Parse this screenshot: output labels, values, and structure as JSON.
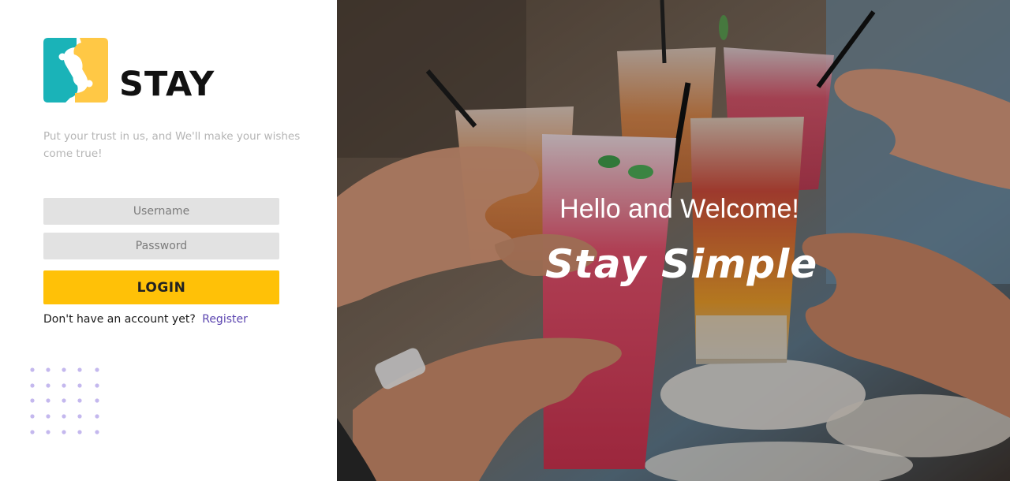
{
  "brand": {
    "name": "STAY",
    "tagline": "Put your trust in us, and We'll make your wishes come true!"
  },
  "login_form": {
    "username_placeholder": "Username",
    "password_placeholder": "Password",
    "login_label": "LOGIN",
    "no_account_text": "Don't have an account yet?",
    "register_label": "Register"
  },
  "hero": {
    "title": "Hello and Welcome!",
    "subtitle": "Stay Simple"
  },
  "colors": {
    "accent_yellow": "#ffc107",
    "logo_teal": "#1ab3b8",
    "logo_yellow": "#ffc845",
    "link_purple": "#5b45b0",
    "dot_lavender": "#c4b8ee"
  },
  "icons": {
    "logo": "stay-logo-icon",
    "decoration": "dot-grid-icon"
  }
}
